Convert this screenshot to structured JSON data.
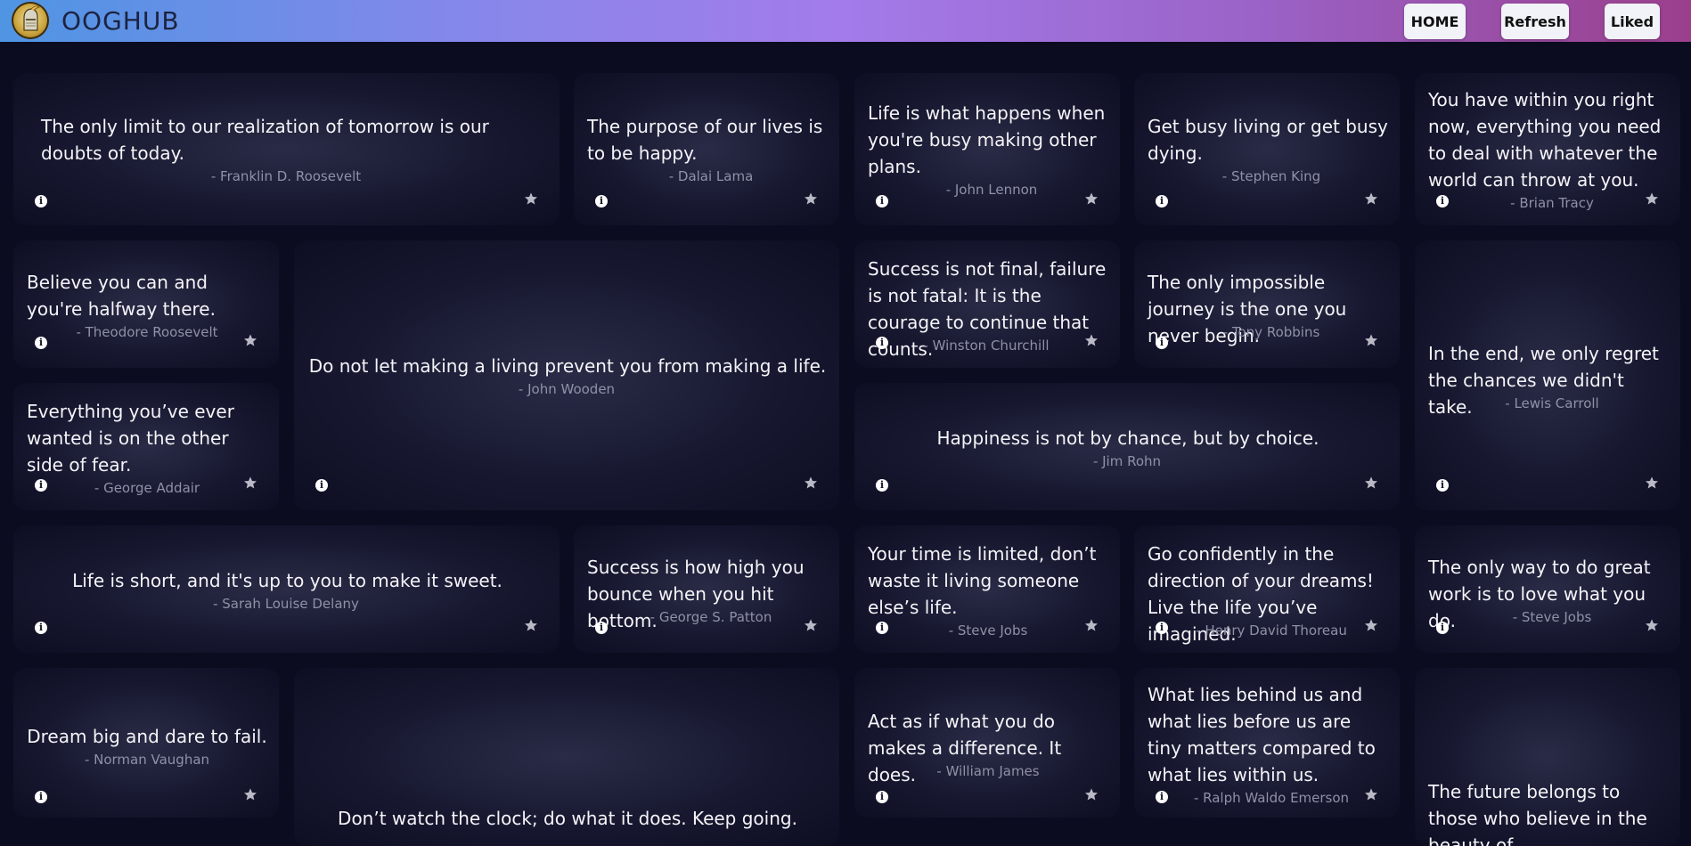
{
  "header": {
    "brand": "OOGHUB",
    "buttons": [
      {
        "label": "HOME"
      },
      {
        "label": "Refresh"
      },
      {
        "label": "Liked"
      }
    ]
  },
  "icons": {
    "info": "info-icon",
    "favorite": "star-icon",
    "logo": "knight-helmet-logo"
  },
  "colors": {
    "background": "#0b0c1f",
    "card": "#1a1b33",
    "quote_text": "#f4f4f8",
    "author_text": "#8f91a6"
  },
  "quotes": [
    {
      "text": "The only limit to our realization of tomorrow is our doubts of today.",
      "author": "- Franklin D. Roosevelt"
    },
    {
      "text": "The purpose of our lives is to be happy.",
      "author": "- Dalai Lama"
    },
    {
      "text": "Life is what happens when you're busy making other plans.",
      "author": "- John Lennon"
    },
    {
      "text": "Get busy living or get busy dying.",
      "author": "- Stephen King"
    },
    {
      "text": "You have within you right now, everything you need to deal with whatever the world can throw at you.",
      "author": "- Brian Tracy"
    },
    {
      "text": "Believe you can and you're halfway there.",
      "author": "- Theodore Roosevelt"
    },
    {
      "text": "Do not let making a living prevent you from making a life.",
      "author": "- John Wooden"
    },
    {
      "text": "Success is not final, failure is not fatal: It is the courage to continue that counts.",
      "author": "- Winston Churchill"
    },
    {
      "text": "The only impossible journey is the one you never begin.",
      "author": "- Tony Robbins"
    },
    {
      "text": "In the end, we only regret the chances we didn't take.",
      "author": "- Lewis Carroll"
    },
    {
      "text": "Everything you’ve ever wanted is on the other side of fear.",
      "author": "- George Addair"
    },
    {
      "text": "Happiness is not by chance, but by choice.",
      "author": "- Jim Rohn"
    },
    {
      "text": "Life is short, and it's up to you to make it sweet.",
      "author": "- Sarah Louise Delany"
    },
    {
      "text": "Success is how high you bounce when you hit bottom.",
      "author": "- George S. Patton"
    },
    {
      "text": "Your time is limited, don’t waste it living someone else’s life.",
      "author": "- Steve Jobs"
    },
    {
      "text": "Go confidently in the direction of your dreams! Live the life you’ve imagined.",
      "author": "- Henry David Thoreau"
    },
    {
      "text": "The only way to do great work is to love what you do.",
      "author": "- Steve Jobs"
    },
    {
      "text": "Dream big and dare to fail.",
      "author": "- Norman Vaughan"
    },
    {
      "text": "Don’t watch the clock; do what it does. Keep going.",
      "author": ""
    },
    {
      "text": "Act as if what you do makes a difference. It does.",
      "author": "- William James"
    },
    {
      "text": "What lies behind us and what lies before us are tiny matters compared to what lies within us.",
      "author": "- Ralph Waldo Emerson"
    },
    {
      "text": "The future belongs to those who believe in the beauty of",
      "author": ""
    }
  ]
}
